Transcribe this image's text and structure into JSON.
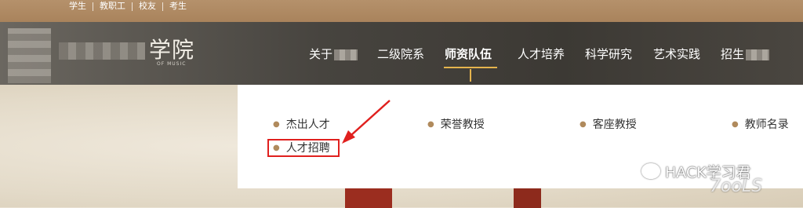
{
  "top_links": [
    "学生",
    "教职工",
    "校友",
    "考生"
  ],
  "logo": {
    "calligraphy": "学院",
    "subtitle": "OF MUSIC"
  },
  "nav": {
    "items": [
      "关于",
      "二级院系",
      "师资队伍",
      "人才培养",
      "科学研究",
      "艺术实践",
      "招生"
    ],
    "active": "师资队伍"
  },
  "dropdown": {
    "items": [
      "杰出人才",
      "荣誉教授",
      "客座教授",
      "教师名录",
      "人才招聘"
    ],
    "highlighted": "人才招聘"
  },
  "watermark": {
    "text": "HACK学习君",
    "subtext": "7ooLS"
  },
  "colors": {
    "accent": "#e5b44d",
    "highlight": "#e0201e",
    "topbar": "#a9835c"
  }
}
